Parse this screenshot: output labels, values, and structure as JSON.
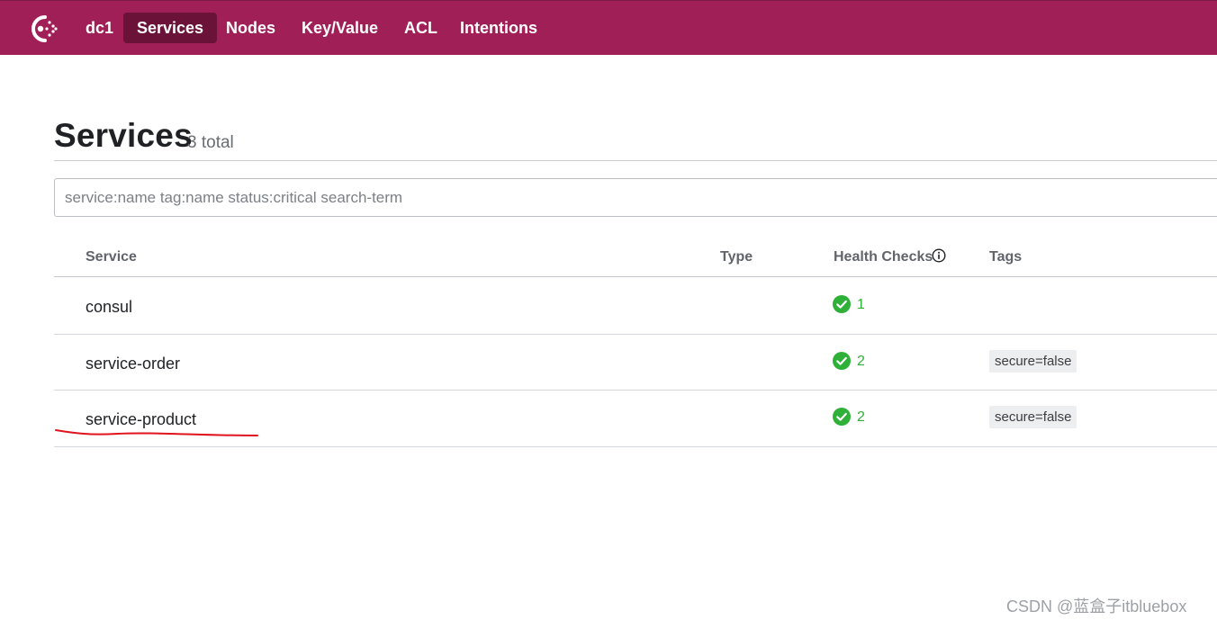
{
  "nav": {
    "datacenter": "dc1",
    "items": [
      {
        "label": "Services",
        "active": true
      },
      {
        "label": "Nodes"
      },
      {
        "label": "Key/Value"
      },
      {
        "label": "ACL"
      },
      {
        "label": "Intentions"
      }
    ]
  },
  "header": {
    "title": "Services",
    "count": "3 total"
  },
  "search": {
    "placeholder": "service:name tag:name status:critical search-term",
    "value": ""
  },
  "table": {
    "columns": [
      "Service",
      "Type",
      "Health Checks",
      "Tags"
    ],
    "rows": [
      {
        "name": "consul",
        "type": "",
        "checks": "1",
        "tags": []
      },
      {
        "name": "service-order",
        "type": "",
        "checks": "2",
        "tags": [
          "secure=false"
        ]
      },
      {
        "name": "service-product",
        "type": "",
        "checks": "2",
        "tags": [
          "secure=false"
        ]
      }
    ]
  },
  "watermark": "CSDN @蓝盒子itbluebox",
  "colors": {
    "brand": "#a01f57",
    "nav_active": "#6b1239",
    "passing": "#2eb039",
    "annotation": "#e0141e"
  }
}
